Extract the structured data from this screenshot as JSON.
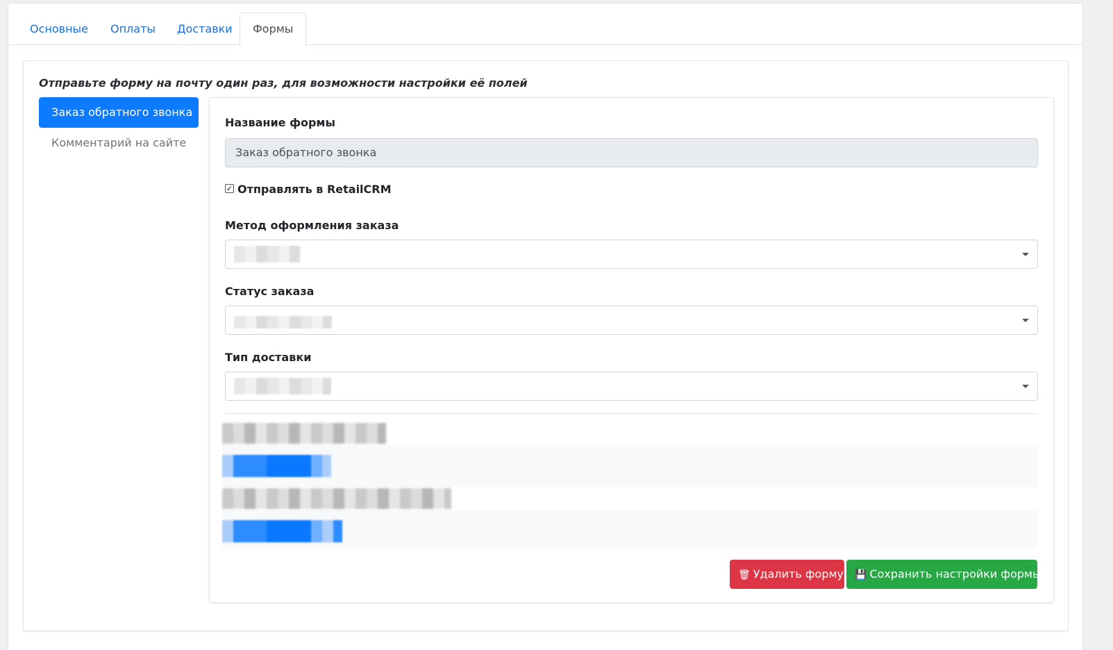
{
  "tabs": [
    {
      "label": "Основные",
      "active": false
    },
    {
      "label": "Оплаты",
      "active": false
    },
    {
      "label": "Доставки",
      "active": false
    },
    {
      "label": "Формы",
      "active": true
    }
  ],
  "hint": "Отправьте форму на почту один раз, для возможности настройки её полей",
  "forms_list": [
    {
      "label": "Заказ обратного звонка",
      "active": true
    },
    {
      "label": "Комментарий на сайте",
      "active": false
    }
  ],
  "form": {
    "name_label": "Название формы",
    "name_value": "Заказ обратного звонка",
    "send_checkbox_label": "Отправлять в RetailCRM",
    "send_checked": true,
    "method_label": "Метод оформления заказа",
    "status_label": "Статус заказа",
    "delivery_label": "Тип доставки"
  },
  "actions": {
    "delete_label": "Удалить форму",
    "save_label": "Сохранить настройки формы"
  },
  "colors": {
    "primary": "#0d7bff",
    "danger": "#dc3545",
    "success": "#28a745",
    "link": "#1b6ed6"
  },
  "icons": {
    "delete": "trash-icon",
    "save": "floppy-disk-icon",
    "select": "chevron-down-icon"
  }
}
